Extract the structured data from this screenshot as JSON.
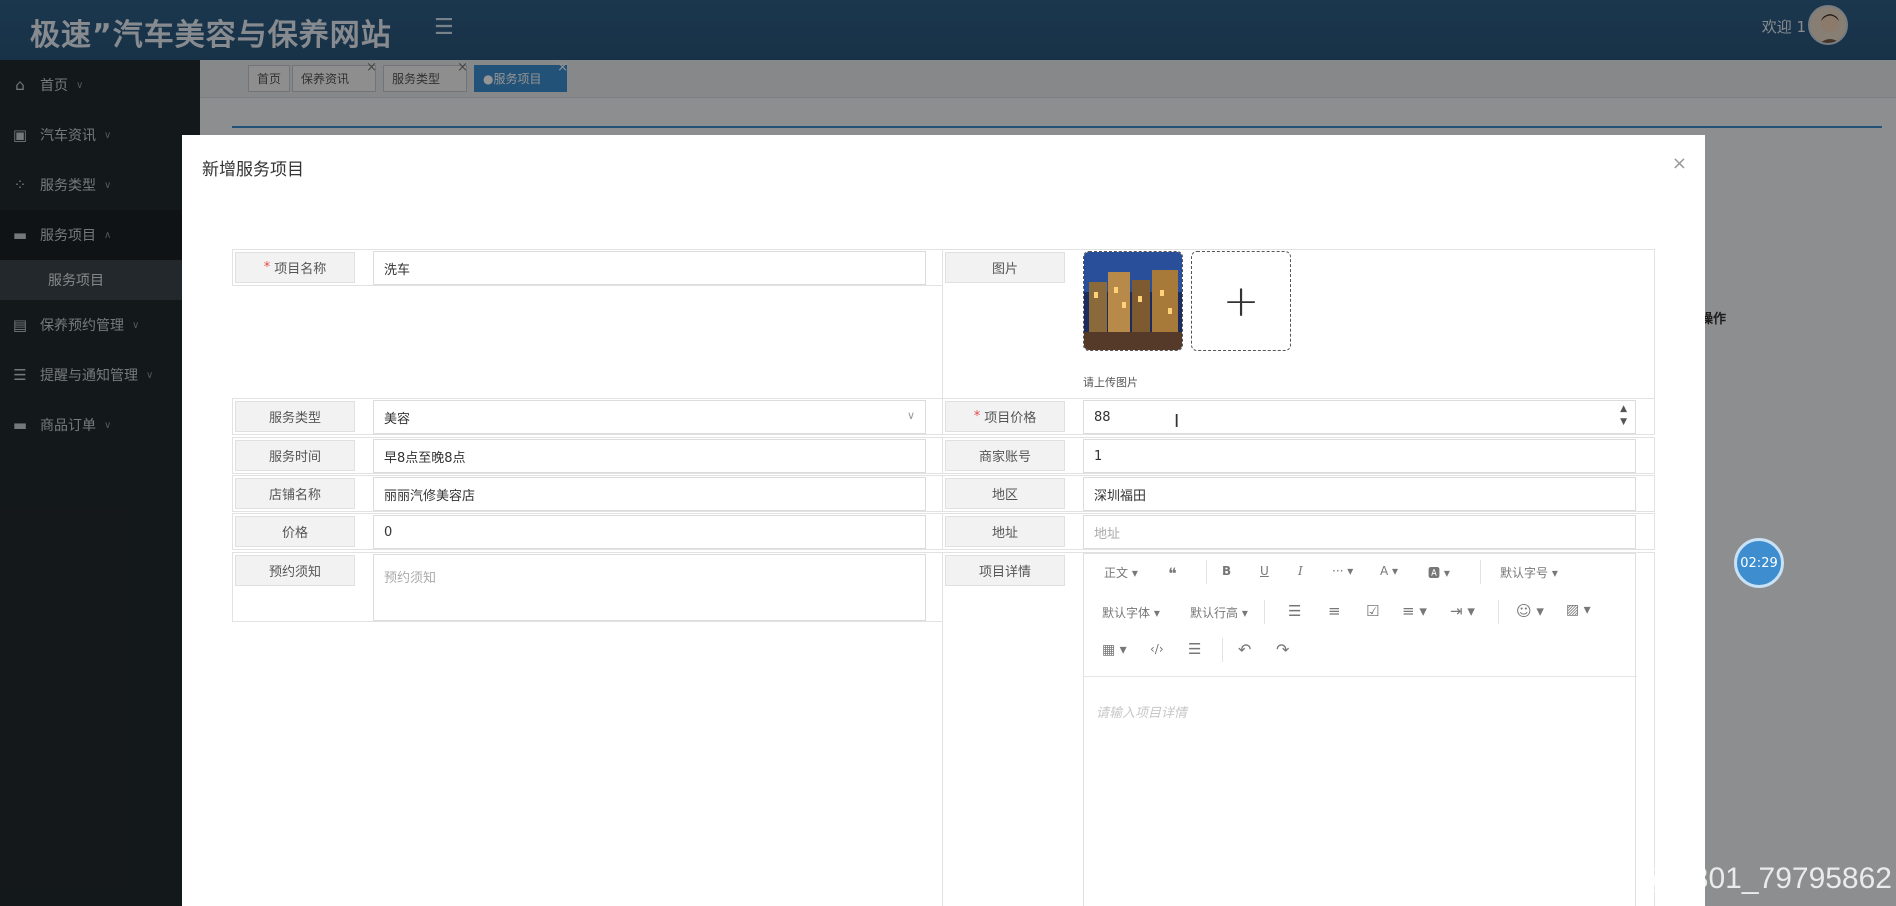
{
  "header": {
    "brand": "极速”汽车美容与保养网站",
    "menu_icon": "hamburger-icon",
    "welcome": "欢迎 1"
  },
  "sidebar": {
    "items": [
      {
        "label": "首页",
        "icon": "home-icon",
        "chevron": "∨"
      },
      {
        "label": "汽车资讯",
        "icon": "news-icon",
        "chevron": "∨"
      },
      {
        "label": "服务类型",
        "icon": "grid-icon",
        "chevron": "∨"
      },
      {
        "label": "服务项目",
        "icon": "card-icon",
        "chevron": "∧",
        "sub": [
          "服务项目"
        ]
      },
      {
        "label": "保养预约管理",
        "icon": "table-icon",
        "chevron": "∨"
      },
      {
        "label": "提醒与通知管理",
        "icon": "server-icon",
        "chevron": "∨"
      },
      {
        "label": "商品订单",
        "icon": "card-icon",
        "chevron": "∨"
      }
    ]
  },
  "tabs": [
    {
      "label": "首页",
      "closable": false
    },
    {
      "label": "保养资讯",
      "closable": true
    },
    {
      "label": "服务类型",
      "closable": true
    },
    {
      "label": "●服务项目",
      "closable": true,
      "active": true
    }
  ],
  "background": {
    "op_header": "操作"
  },
  "modal": {
    "title": "新增服务项目",
    "close": "×",
    "form": {
      "name_label": "项目名称",
      "name_value": "洗车",
      "image_label": "图片",
      "image_hint": "请上传图片",
      "type_label": "服务类型",
      "type_value": "美容",
      "price_item_label": "项目价格",
      "price_item_value": "88",
      "time_label": "服务时间",
      "time_value": "早8点至晚8点",
      "merchant_label": "商家账号",
      "merchant_value": "1",
      "shop_label": "店铺名称",
      "shop_value": "丽丽汽修美容店",
      "region_label": "地区",
      "region_value": "深圳福田",
      "price_label": "价格",
      "price_value": "0",
      "address_label": "地址",
      "address_placeholder": "地址",
      "notice_label": "预约须知",
      "notice_placeholder": "预约须知",
      "detail_label": "项目详情",
      "detail_placeholder": "请输入项目详情"
    },
    "editor_toolbar": {
      "row1": [
        "正文",
        "❝",
        "B",
        "U",
        "I",
        "···",
        "A",
        "🅰",
        "默认字号"
      ],
      "row2": [
        "默认字体",
        "默认行高"
      ],
      "row3": []
    }
  },
  "timer": "02:29",
  "watermark": "CSDN @2301_79795862"
}
